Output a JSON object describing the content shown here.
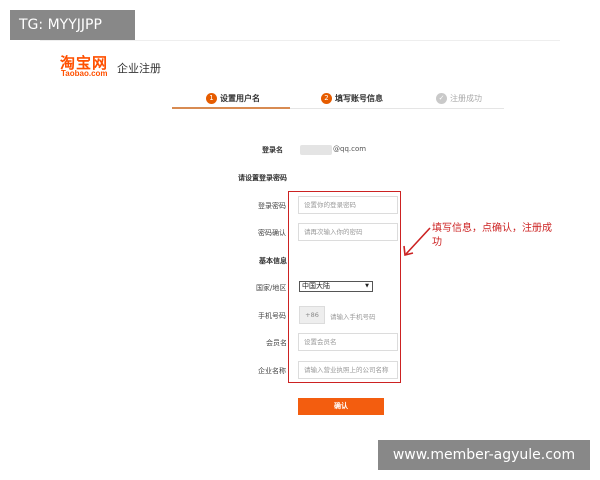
{
  "watermarks": {
    "top_left": "TG: MYYJJPP",
    "bottom_right": "www.member-agyule.com"
  },
  "header": {
    "logo_cn": "淘宝网",
    "logo_en": "Taobao.com",
    "subtitle": "企业注册"
  },
  "steps": [
    {
      "num": "1",
      "label": "设置用户名",
      "state": "active"
    },
    {
      "num": "2",
      "label": "填写账号信息",
      "state": "active"
    },
    {
      "num": "✓",
      "label": "注册成功",
      "state": "pending"
    }
  ],
  "form": {
    "login_name_label": "登录名",
    "login_name_value": "@qq.com",
    "password_section_label": "请设置登录密码",
    "password_label": "登录密码",
    "password_placeholder": "设置你的登录密码",
    "confirm_label": "密码确认",
    "confirm_placeholder": "请再次输入你的密码",
    "basic_info_label": "基本信息",
    "region_label": "国家/地区",
    "region_value": "中国大陆",
    "phone_label": "手机号码",
    "phone_prefix": "+86",
    "phone_placeholder": "请输入手机号码",
    "member_label": "会员名",
    "member_placeholder": "设置会员名",
    "company_label": "企业名称",
    "company_placeholder": "请输入营业执照上的公司名称",
    "confirm_button": "确认"
  },
  "annotation": {
    "text": "填写信息，点确认，注册成功"
  },
  "colors": {
    "brand": "#ff5000",
    "button": "#f35d0f",
    "annotation": "#cc2222"
  }
}
